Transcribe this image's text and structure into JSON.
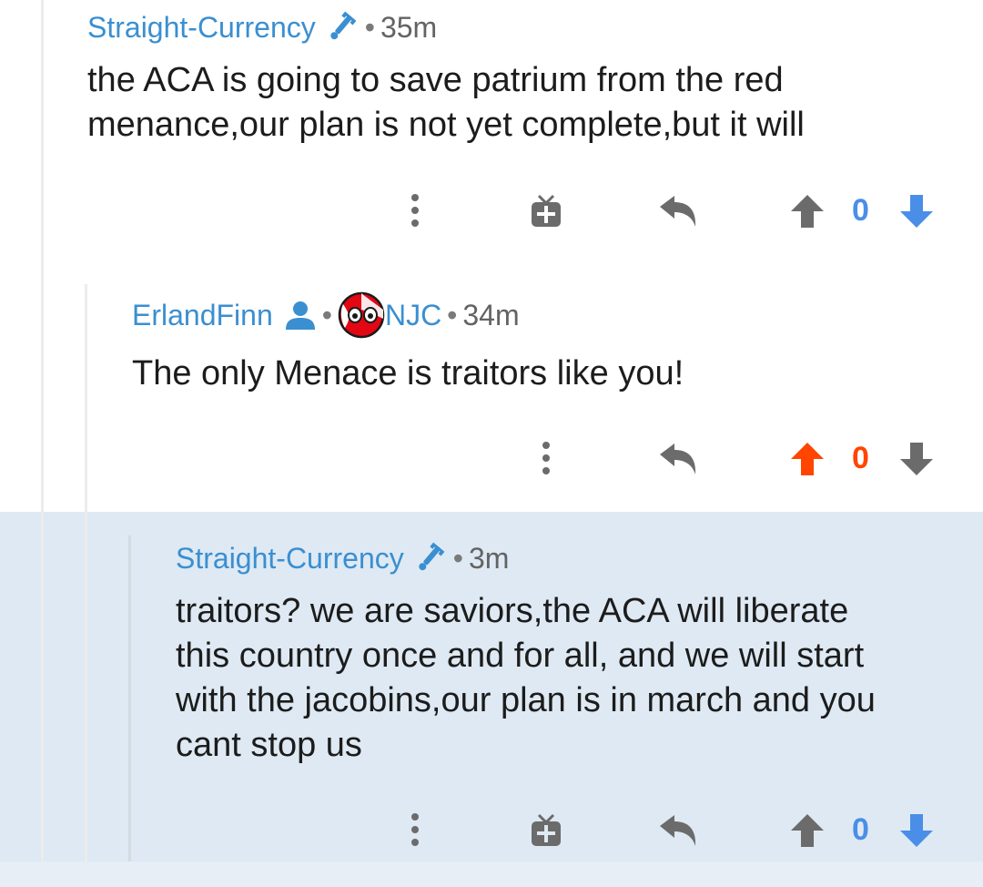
{
  "colors": {
    "username": "#3a8fd1",
    "upvote_active": "#ff4500",
    "vote_blue": "#4a8ee8",
    "icon_gray": "#6b6b6b",
    "highlight_bg": "#dee9f3"
  },
  "comments": [
    {
      "username": "Straight-Currency",
      "user_icon": "wrench-icon",
      "time": "35m",
      "text_lines": [
        "the ACA is going to save patrium from the red",
        "menance,our plan is not yet complete,but it will"
      ],
      "vote_count": "0",
      "upvoted": false,
      "has_award_button": true
    },
    {
      "username": "ErlandFinn",
      "user_icon": "person-icon",
      "flair_icon": "flag-ball-icon",
      "flair": "NJC",
      "time": "34m",
      "text_lines": [
        "The only Menace is traitors like you!"
      ],
      "vote_count": "0",
      "upvoted": true,
      "has_award_button": false
    },
    {
      "username": "Straight-Currency",
      "user_icon": "wrench-icon",
      "time": "3m",
      "text_lines": [
        "traitors? we are saviors,the ACA will liberate",
        "this country once and for all, and we will start",
        "with the jacobins,our plan is in march and you",
        "cant stop us"
      ],
      "vote_count": "0",
      "upvoted": false,
      "has_award_button": true,
      "highlighted": true
    }
  ]
}
